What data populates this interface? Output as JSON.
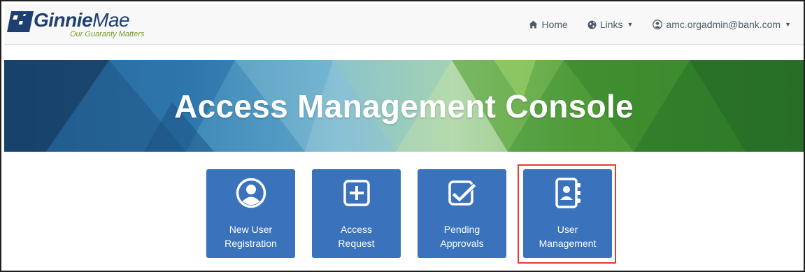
{
  "navbar": {
    "brand": {
      "name_bold": "Ginnie",
      "name_light": "Mae",
      "tagline": "Our Guaranty Matters"
    },
    "items": [
      {
        "label": "Home",
        "icon": "home-icon"
      },
      {
        "label": "Links",
        "icon": "globe-icon",
        "dropdown": true
      },
      {
        "label": "amc.orgadmin@bank.com",
        "icon": "user-circle-icon",
        "dropdown": true
      }
    ]
  },
  "banner": {
    "title": "Access Management Console"
  },
  "tiles": [
    {
      "line1": "New User",
      "line2": "Registration",
      "icon": "user-circle-icon"
    },
    {
      "line1": "Access",
      "line2": "Request",
      "icon": "plus-square-icon"
    },
    {
      "line1": "Pending",
      "line2": "Approvals",
      "icon": "check-square-icon"
    },
    {
      "line1": "User",
      "line2": "Management",
      "icon": "address-book-icon",
      "highlighted": true
    }
  ],
  "colors": {
    "brand_navy": "#1d3f72",
    "tagline_green": "#7a9a2b",
    "tile_blue": "#3a72bb",
    "highlight_red": "#e53935"
  }
}
